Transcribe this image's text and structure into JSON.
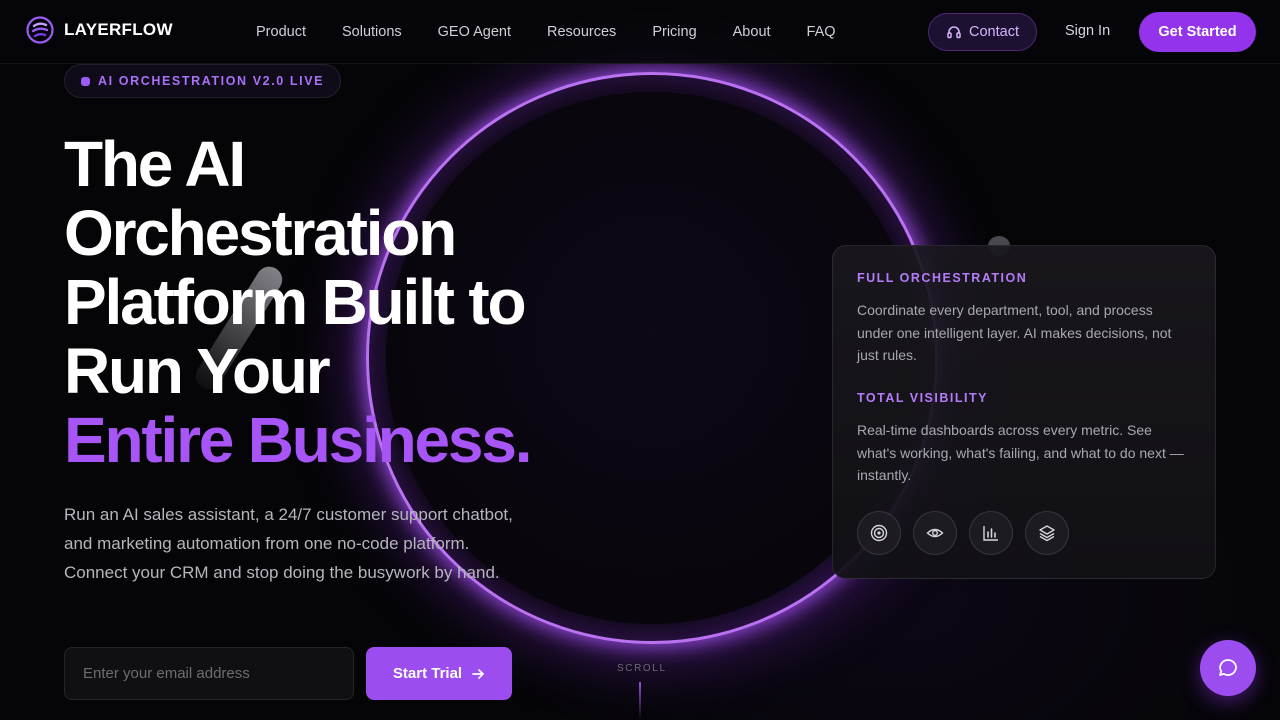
{
  "brand": {
    "name": "LAYERFLOW",
    "logo_icon": "layerflow-logo-icon",
    "accent_color": "#9333ea"
  },
  "nav": {
    "items": [
      {
        "label": "Product"
      },
      {
        "label": "Solutions"
      },
      {
        "label": "GEO Agent"
      },
      {
        "label": "Resources"
      },
      {
        "label": "Pricing"
      },
      {
        "label": "About"
      },
      {
        "label": "FAQ"
      }
    ],
    "contact_label": "Contact",
    "contact_icon": "headset-icon",
    "signin_label": "Sign In",
    "get_started_label": "Get Started"
  },
  "hero": {
    "badge": "AI ORCHESTRATION V2.0 LIVE",
    "headline_lines": [
      "The AI",
      "Orchestration",
      "Platform Built to",
      "Run Your"
    ],
    "headline_accent": "Entire Business.",
    "subcopy": "Run an AI sales assistant, a 24/7 customer support chatbot, and marketing automation from one no-code platform. Connect your CRM and stop doing the busywork by hand.",
    "email_placeholder": "Enter your email address",
    "cta_label": "Start Trial",
    "cta_icon": "arrow-right-icon",
    "scroll_label": "SCROLL"
  },
  "card": {
    "sections": [
      {
        "title": "FULL ORCHESTRATION",
        "body": "Coordinate every department, tool, and process under one intelligent layer. AI makes decisions, not just rules."
      },
      {
        "title": "TOTAL VISIBILITY",
        "body": "Real-time dashboards across every metric. See what's working, what's failing, and what to do next — instantly."
      }
    ],
    "icons": [
      "target-icon",
      "eye-icon",
      "bar-chart-icon",
      "layers-icon"
    ]
  },
  "chat": {
    "icon": "chat-bubble-icon"
  }
}
